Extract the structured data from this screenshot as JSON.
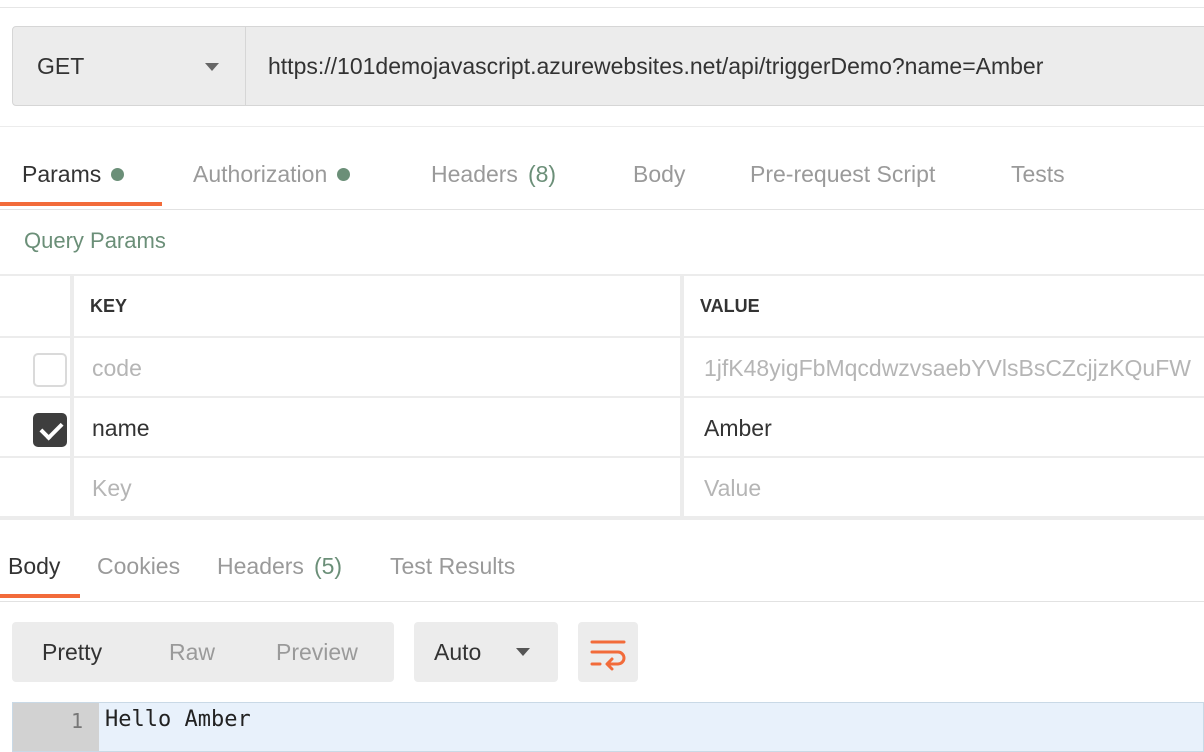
{
  "request": {
    "method": "GET",
    "url": "https://101demojavascript.azurewebsites.net/api/triggerDemo?name=Amber"
  },
  "request_tabs": {
    "params": "Params",
    "authorization": "Authorization",
    "headers": "Headers",
    "headers_count": "(8)",
    "body": "Body",
    "pre_request": "Pre-request Script",
    "tests": "Tests"
  },
  "query_params": {
    "title": "Query Params",
    "columns": {
      "key": "KEY",
      "value": "VALUE"
    },
    "rows": [
      {
        "key": "code",
        "value": "1jfK48yigFbMqcdwzvsaebYVlsBsCZcjjzKQuFW",
        "checked": false
      },
      {
        "key": "name",
        "value": "Amber",
        "checked": true
      }
    ],
    "placeholder": {
      "key": "Key",
      "value": "Value"
    }
  },
  "response_tabs": {
    "body": "Body",
    "cookies": "Cookies",
    "headers": "Headers",
    "headers_count": "(5)",
    "test_results": "Test Results"
  },
  "response_view": {
    "pretty": "Pretty",
    "raw": "Raw",
    "preview": "Preview",
    "format": "Auto"
  },
  "response_body": {
    "line_number": "1",
    "text": "Hello Amber"
  },
  "colors": {
    "accent": "#f26b3a",
    "dot": "#6b8f78",
    "editor_bg": "#e8f1fb"
  }
}
